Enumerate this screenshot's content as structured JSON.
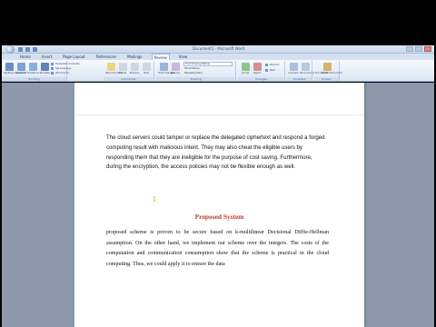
{
  "window": {
    "title": "Document1 - Microsoft Word"
  },
  "tabs": [
    "Home",
    "Insert",
    "Page Layout",
    "References",
    "Mailings",
    "Review",
    "View"
  ],
  "active_tab": "Review",
  "ribbon": {
    "groups": [
      {
        "label": "Proofing",
        "buttons": [
          "Spelling & Grammar",
          "Research",
          "Thesaurus",
          "Translate"
        ],
        "small": [
          "Translation ScreenTip",
          "Set Language",
          "Word Count"
        ]
      },
      {
        "label": "Comments",
        "buttons": [
          "New Comment",
          "Delete",
          "Previous",
          "Next"
        ]
      },
      {
        "label": "Tracking",
        "buttons": [
          "Track Changes",
          "Balloons"
        ],
        "dropdowns": [
          "Final Showing Markup",
          "Show Markup",
          "Reviewing Pane"
        ]
      },
      {
        "label": "Changes",
        "buttons": [
          "Accept",
          "Reject"
        ],
        "small": [
          "Previous",
          "Next"
        ]
      },
      {
        "label": "Compare",
        "buttons": [
          "Compare",
          "Show Source Documents"
        ]
      },
      {
        "label": "Protect",
        "buttons": [
          "Protect Document"
        ]
      }
    ]
  },
  "document": {
    "para1": "The cloud servers could tamper or replace the delegated ciphertext and respond a forged computing result with malicious intent. They may also cheat the eligible users by responding them that they are ineligible for the purpose of cost saving. Furthermore, during the encryption, the access policies may not be flexible enough as well.",
    "heading": "Proposed System",
    "para2": "proposed scheme is proven to be secure based on k-multilinear Decisional Diffie-Hellman assumption. On the other hand, we implement our scheme over the integers. The costs of the computation and communication consumption show that the scheme is practical in the cloud computing. Thus, we could apply it to ensure the data"
  },
  "colors": {
    "heading": "#c0392b",
    "ribbon_bg": "#dbe6f3",
    "workspace": "#8d99aa"
  }
}
